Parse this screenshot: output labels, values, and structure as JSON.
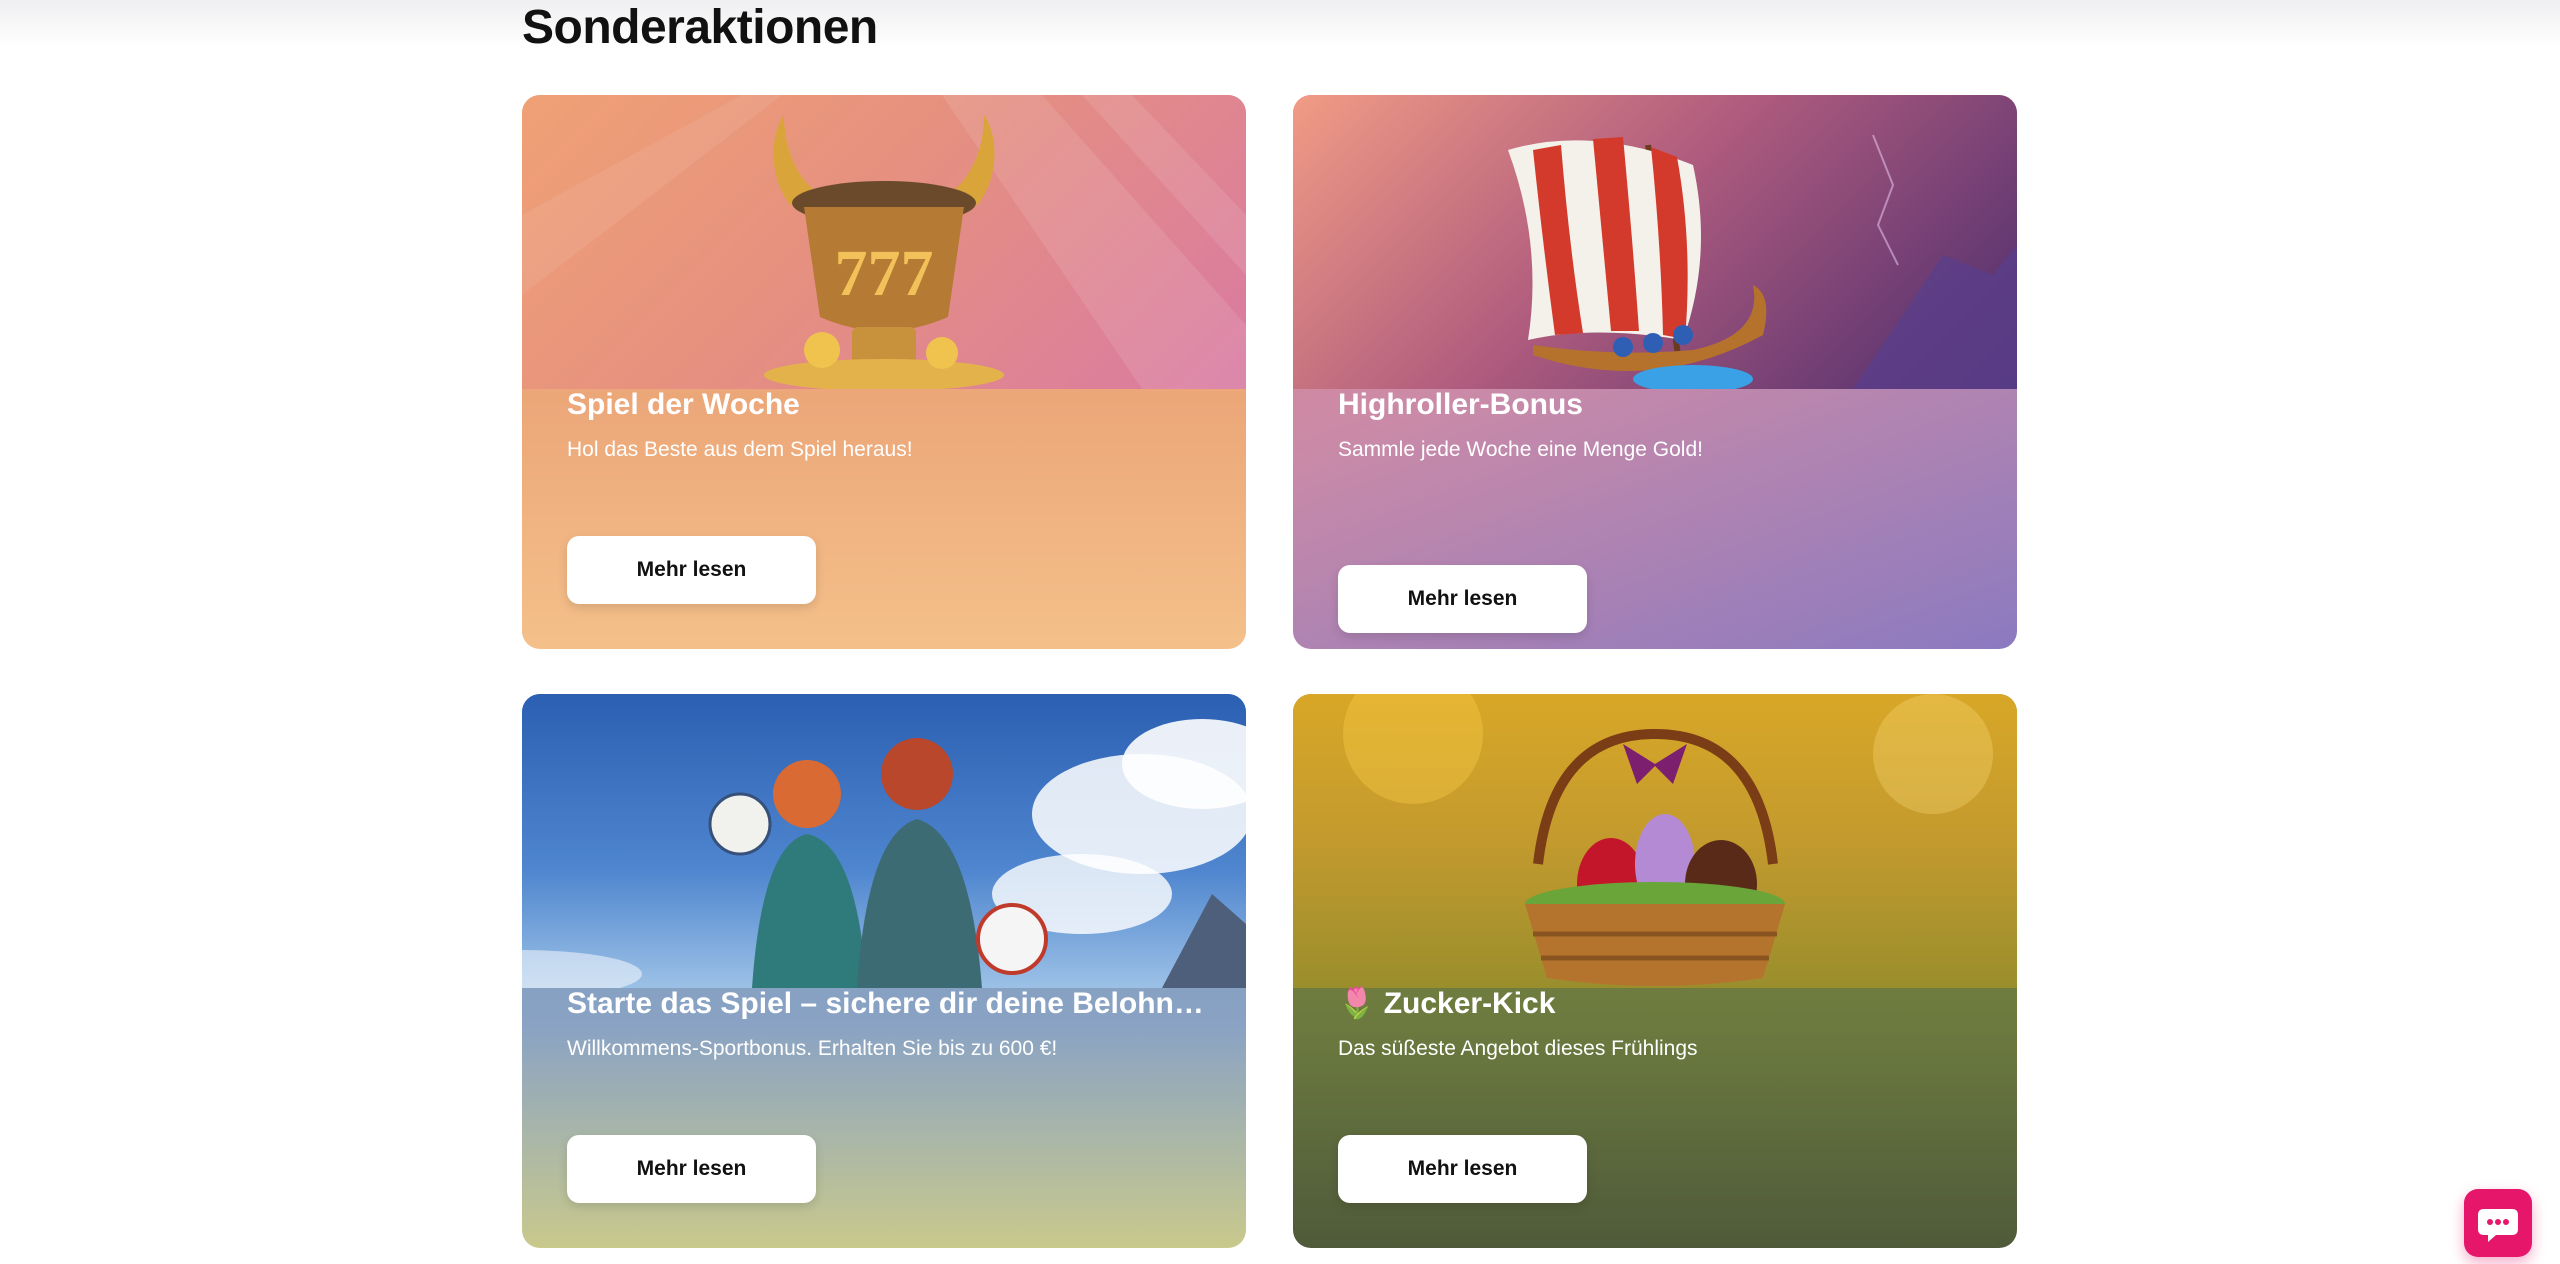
{
  "page": {
    "title": "Sonderaktionen"
  },
  "cards": [
    {
      "title": "Spiel der Woche",
      "subtitle": "Hol das Beste aus dem Spiel heraus!",
      "button_label": "Mehr lesen"
    },
    {
      "title": "Highroller-Bonus",
      "subtitle": "Sammle jede Woche eine Menge Gold!",
      "button_label": "Mehr lesen"
    },
    {
      "title": "Starte das Spiel – sichere dir deine Belohnu...",
      "subtitle": "Willkommens-Sportbonus. Erhalten Sie bis zu  600 €!",
      "button_label": "Mehr lesen"
    },
    {
      "title": "🌷 Zucker-Kick",
      "subtitle": "Das süßeste Angebot dieses Frühlings",
      "button_label": "Mehr lesen"
    }
  ],
  "icons": {
    "chat": "chat-bubble-icon"
  }
}
